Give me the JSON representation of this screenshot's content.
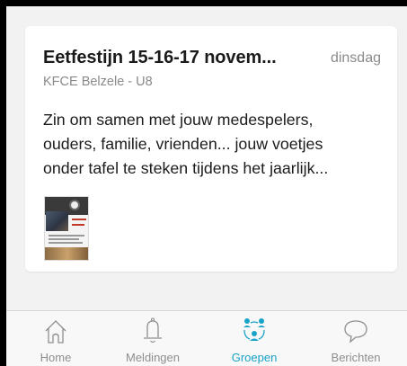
{
  "post": {
    "title": "Eetfestijn 15-16-17 novem...",
    "date": "dinsdag",
    "group": "KFCE Belzele - U8",
    "body_lines": [
      "Zin om samen met jouw medespelers,",
      "ouders, familie, vrienden... jouw voetjes",
      "onder tafel te steken tijdens het jaarlijk..."
    ]
  },
  "tabbar": {
    "accent_color": "#1aa3c9",
    "inactive_color": "#8e8e8e",
    "tabs": [
      {
        "label": "Home",
        "icon": "home-icon",
        "active": false
      },
      {
        "label": "Meldingen",
        "icon": "bell-icon",
        "active": false
      },
      {
        "label": "Groepen",
        "icon": "groups-icon",
        "active": true
      },
      {
        "label": "Berichten",
        "icon": "chat-bubble-icon",
        "active": false
      }
    ]
  }
}
